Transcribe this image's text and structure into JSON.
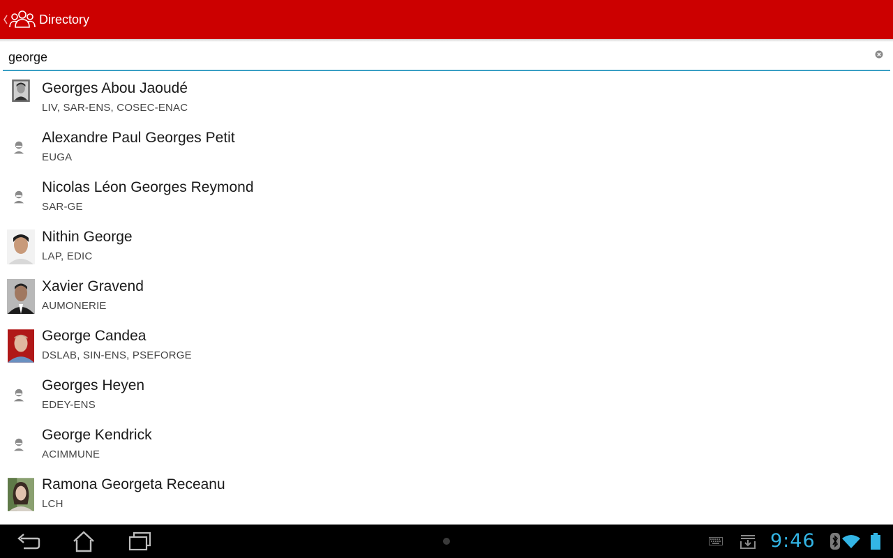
{
  "action_bar": {
    "title": "Directory",
    "up_icon": "chevron-left-icon",
    "app_icon": "people-group-icon",
    "color": "#cc0000"
  },
  "search": {
    "value": "george",
    "clear_icon": "clear-circle-icon",
    "underline_color": "#3a9fc4"
  },
  "results": [
    {
      "name": "Georges Abou Jaoudé",
      "units": "LIV, SAR-ENS, COSEC-ENAC",
      "avatar": "photo"
    },
    {
      "name": "Alexandre Paul Georges Petit",
      "units": "EUGA",
      "avatar": "placeholder-person-icon"
    },
    {
      "name": "Nicolas Léon Georges Reymond",
      "units": "SAR-GE",
      "avatar": "placeholder-person-icon"
    },
    {
      "name": "Nithin George",
      "units": "LAP, EDIC",
      "avatar": "photo"
    },
    {
      "name": "Xavier Gravend",
      "units": "AUMONERIE",
      "avatar": "photo"
    },
    {
      "name": "George Candea",
      "units": "DSLAB, SIN-ENS, PSEFORGE",
      "avatar": "photo"
    },
    {
      "name": "Georges Heyen",
      "units": "EDEY-ENS",
      "avatar": "placeholder-person-icon"
    },
    {
      "name": "George Kendrick",
      "units": "ACIMMUNE",
      "avatar": "placeholder-person-icon"
    },
    {
      "name": "Ramona Georgeta Receanu",
      "units": "LCH",
      "avatar": "photo"
    }
  ],
  "nav_bar": {
    "back_icon": "back-arrow-icon",
    "home_icon": "home-icon",
    "recents_icon": "recent-apps-icon",
    "clock": "9:46",
    "status_icons": [
      "keyboard-icon",
      "download-icon",
      "bluetooth-icon",
      "wifi-icon",
      "battery-icon"
    ],
    "accent": "#33b5e5"
  }
}
